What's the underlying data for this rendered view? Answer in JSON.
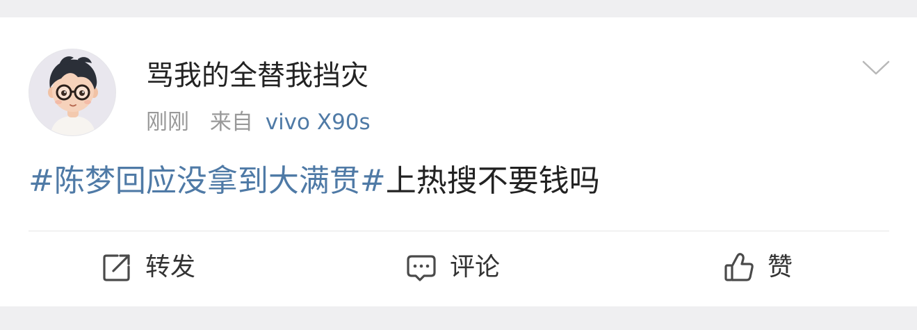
{
  "post": {
    "author_name": "骂我的全替我挡灾",
    "time": "刚刚",
    "source_prefix": "来自",
    "device": "vivo X90s",
    "hashtag": "#陈梦回应没拿到大满贯#",
    "text_after_hashtag": "上热搜不要钱吗"
  },
  "actions": {
    "repost_label": "转发",
    "comment_label": "评论",
    "like_label": "赞"
  },
  "icons": {
    "avatar": "cartoon-boy-with-glasses-avatar",
    "menu": "chevron-down-icon",
    "repost": "repost-icon",
    "comment": "comment-icon",
    "like": "thumbs-up-icon"
  },
  "colors": {
    "link": "#4f7aa6",
    "text": "#222222",
    "muted": "#999999",
    "background": "#efeff1"
  }
}
